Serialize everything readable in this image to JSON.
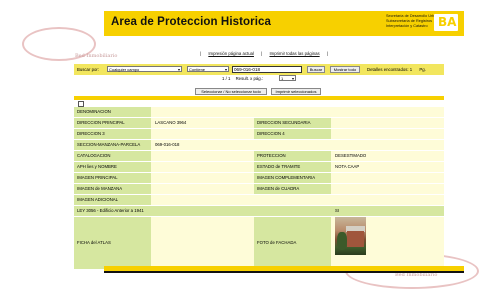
{
  "header": {
    "title": "Area de Proteccion Historica",
    "org_line1": "Secretaría de Desarrollo Urbano",
    "org_line2": "Subsecretaría de Registros",
    "org_line3": "Interpretación y Catastro",
    "logo_text": "BA"
  },
  "watermark": {
    "top": "Bed Inmobiliario",
    "bottom": "Bed Inmobiliario"
  },
  "links": {
    "sep1": "|",
    "print_page": "Impresión página actual",
    "sep2": "|",
    "print_all": "Imprimir todas las páginas",
    "sep3": "|"
  },
  "search": {
    "label": "Buscar por:",
    "field_select": "Cualquier campo",
    "mode_select": "Contiene",
    "query": "069-016-018",
    "buscar_btn": "Buscar",
    "mostrar_btn": "Mostrar todo",
    "count_label": "Detalles encontrados: 1",
    "count_pg": "Pg."
  },
  "pager": {
    "pages": "1 / 1",
    "results_label": "Result. x pág.:",
    "per_page": "1"
  },
  "actions": {
    "select_toggle": "Seleccionar / No seleccionar todo",
    "print_selected": "Imprimir seleccionados"
  },
  "table": {
    "denominacion": "DENOMINACION",
    "direccion_principal": "DIRECCION PRINCIPAL",
    "direccion_principal_val": "LASCANO 3964",
    "direccion_secundaria": "DIRECCION SECUNDARIA",
    "direccion_3": "DIRECCION 3",
    "direccion_4": "DIRECCION 4",
    "smp": "SECCION-MANZANA-PARCELA",
    "smp_val": "069-016-018",
    "catalogacion": "CATALOGACION",
    "proteccion": "PROTECCION",
    "proteccion_val": "DESESTIMADO",
    "aph": "APH lies y NOMBRE",
    "estado_tramite": "ESTADO de TRAMITE",
    "estado_tramite_val": "NOTA CAAP",
    "imagen_principal": "IMAGEN PRINCIPAL",
    "imagen_complementaria": "IMAGEN COMPLEMENTARIA",
    "imagen_manzana": "IMAGEN de MANZANA",
    "imagen_cuadra": "IMAGEN de CUADRA",
    "imagen_adicional": "IMAGEN ADICIONAL",
    "ley": "LEY 3056 - Edificio Anterior a 1941",
    "ley_val": "SI",
    "ficha_atlas": "FICHA del ATLAS",
    "foto_fachada": "FOTO de FACHADA"
  }
}
